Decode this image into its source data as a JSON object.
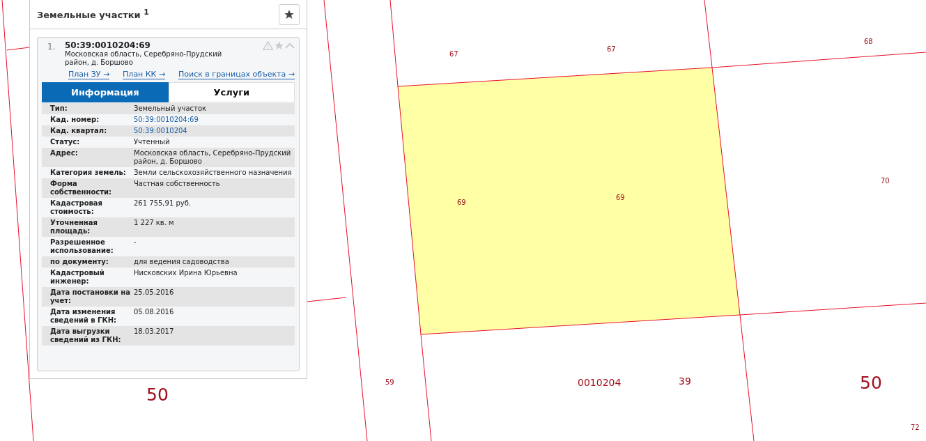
{
  "panel": {
    "title": "Земельные участки $^{1}$",
    "item": {
      "number": "1.",
      "cad_number": "50:39:0010204:69",
      "address": "Московская область, Серебряно-Прудский район, д. Боршово",
      "links": [
        "План ЗУ →",
        "План КК →",
        "Поиск в границах объекта →"
      ],
      "tabs": [
        {
          "label": "Информация",
          "selected": true
        },
        {
          "label": "Услуги",
          "selected": false
        }
      ],
      "rows": [
        {
          "label": "Тип:",
          "value": "Земельный участок",
          "kind": "text"
        },
        {
          "label": "Кад. номер:",
          "value": "50:39:0010204:69",
          "kind": "link"
        },
        {
          "label": "Кад. квартал:",
          "value": "50:39:0010204",
          "kind": "link"
        },
        {
          "label": "Статус:",
          "value": "Учтенный",
          "kind": "text"
        },
        {
          "label": "Адрес:",
          "value": "Московская область, Серебряно-Прудский район, д. Боршово",
          "kind": "text"
        },
        {
          "label": "Категория земель:",
          "value": "Земли сельскохозяйственного назначения",
          "kind": "text"
        },
        {
          "label": "Форма собственности:",
          "value": "Частная собственность",
          "kind": "text"
        },
        {
          "label": "Кадастровая стоимость:",
          "value": "261 755,91 руб.",
          "kind": "text"
        },
        {
          "label": "Уточненная площадь:",
          "value": "1 227 кв. м",
          "kind": "text"
        },
        {
          "label": "Разрешенное использование:",
          "value": "-",
          "kind": "text"
        },
        {
          "label": "по документу:",
          "value": "для ведения садоводства",
          "kind": "text"
        },
        {
          "label": "Кадастровый инженер:",
          "value": "Нисковских Ирина Юрьевна",
          "kind": "text"
        },
        {
          "label": "Дата постановки на учет:",
          "value": "25.05.2016",
          "kind": "text"
        },
        {
          "label": "Дата изменения сведений в ГКН:",
          "value": "05.08.2016",
          "kind": "text"
        },
        {
          "label": "Дата выгрузки сведений из ГКН:",
          "value": "18.03.2017",
          "kind": "text"
        }
      ]
    }
  },
  "map": {
    "labels": [
      {
        "text": "67",
        "kind": "small"
      },
      {
        "text": "67",
        "kind": "small"
      },
      {
        "text": "68",
        "kind": "small"
      },
      {
        "text": "69",
        "kind": "small"
      },
      {
        "text": "69",
        "kind": "small"
      },
      {
        "text": "70",
        "kind": "small"
      },
      {
        "text": "59",
        "kind": "small"
      },
      {
        "text": "0010204",
        "kind": "medium"
      },
      {
        "text": "39",
        "kind": "medium"
      },
      {
        "text": "50",
        "kind": "large"
      },
      {
        "text": "50",
        "kind": "large"
      },
      {
        "text": "72",
        "kind": "small"
      }
    ]
  }
}
